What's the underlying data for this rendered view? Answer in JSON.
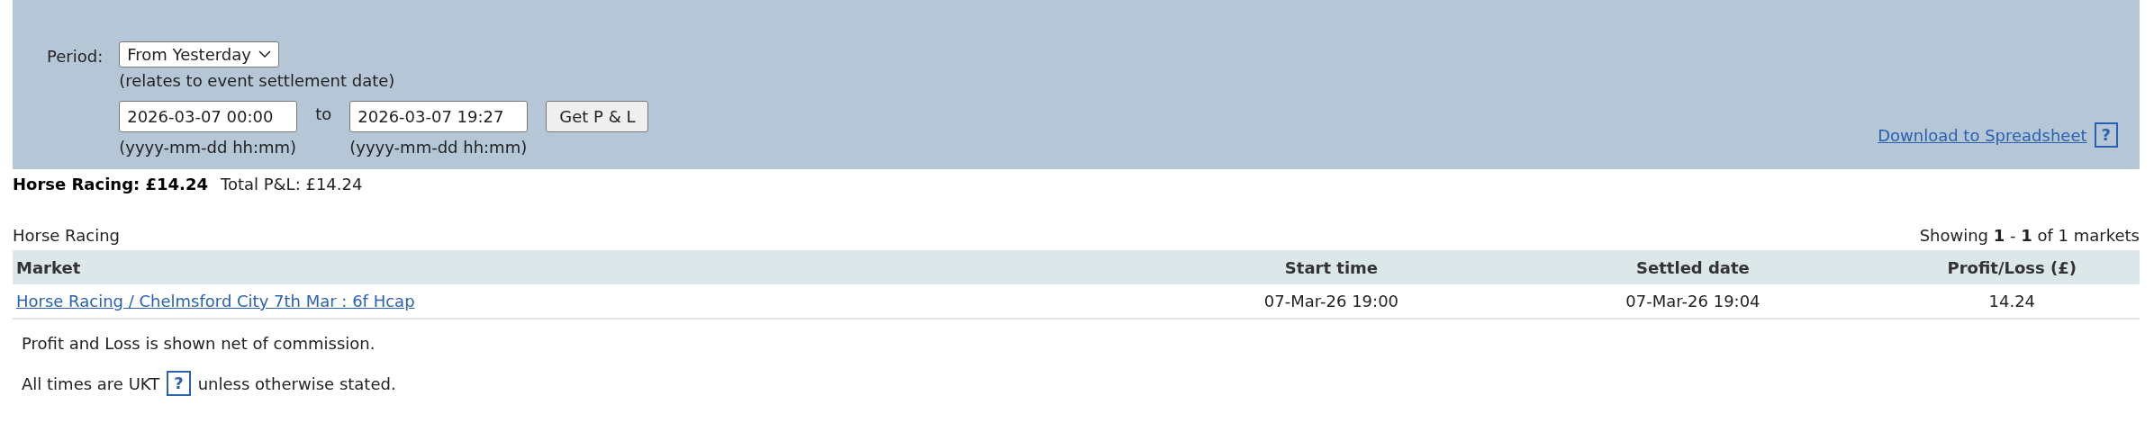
{
  "filter": {
    "period_label": "Period:",
    "period_select": "From Yesterday",
    "period_note": "(relates to event settlement date)",
    "from": {
      "value": "2026-03-07 00:00",
      "hint": "(yyyy-mm-dd hh:mm)"
    },
    "to_label": "to",
    "to": {
      "value": "2026-03-07 19:27",
      "hint": "(yyyy-mm-dd hh:mm)"
    },
    "submit": "Get P & L",
    "download_link": "Download to Spreadsheet",
    "help": "?"
  },
  "summary": {
    "category_total": "Horse Racing: £14.24",
    "total": "Total P&L: £14.24"
  },
  "table": {
    "title": "Horse Racing",
    "showing": "Showing **1** - **1** of 1 markets",
    "columns": [
      "Market",
      "Start time",
      "Settled date",
      "Profit/Loss (£)"
    ],
    "rows": [
      {
        "market": "Horse Racing / Chelmsford City 7th Mar : 6f Hcap",
        "start": "07-Mar-26 19:00",
        "settled": "07-Mar-26 19:04",
        "pl": "14.24"
      }
    ]
  },
  "notes": [
    {
      "text": "Profit and Loss is shown net of commission."
    },
    {
      "before": "All times are UKT",
      "help": "?",
      "after": "unless otherwise stated."
    }
  ]
}
